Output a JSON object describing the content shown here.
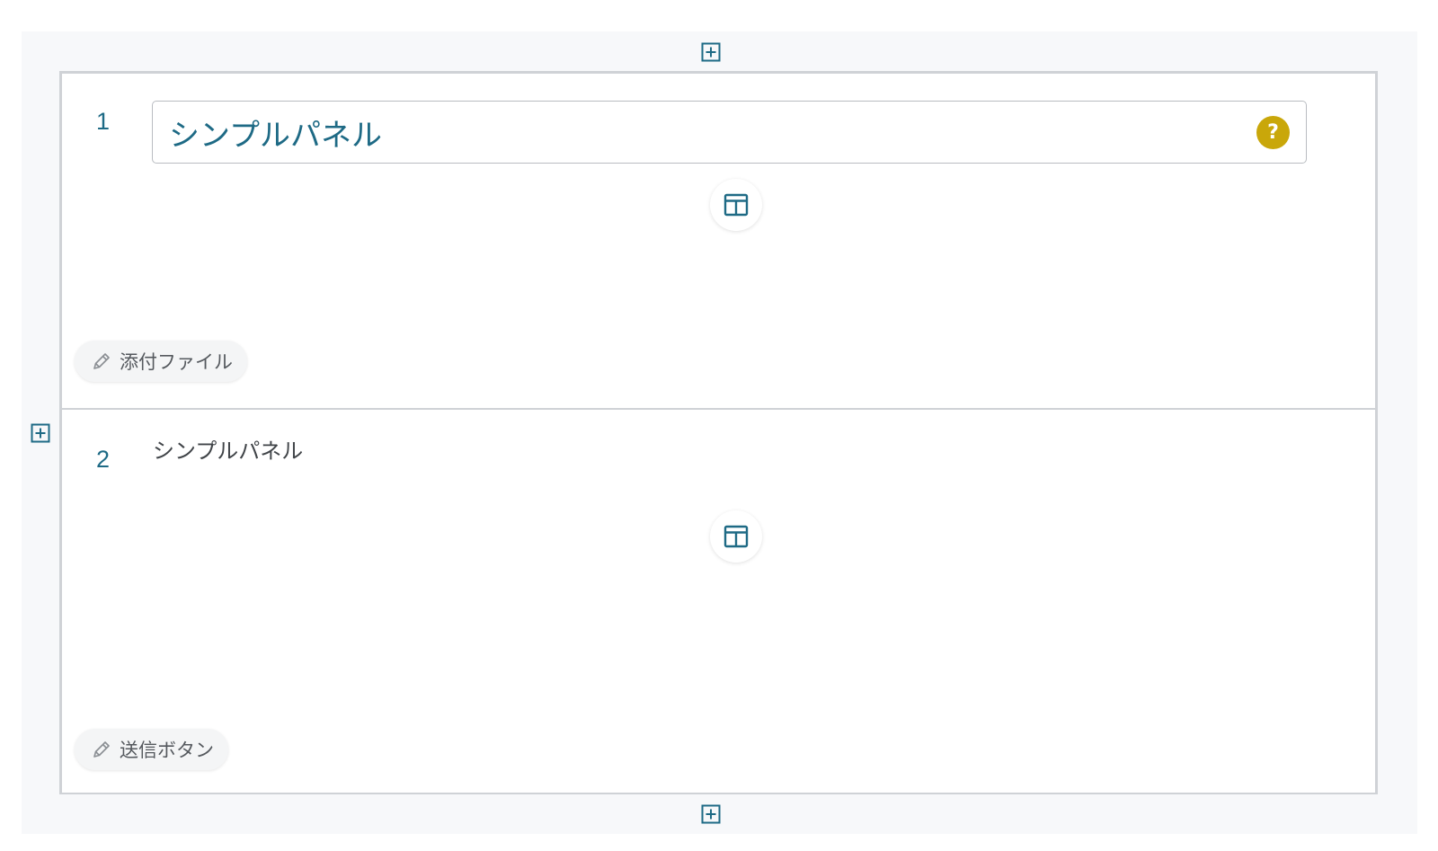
{
  "panels": [
    {
      "number": "1",
      "title": "シンプルパネル",
      "help_icon": "?",
      "layout_icon": "layout-icon",
      "footer_label": "添付ファイル"
    },
    {
      "number": "2",
      "title": "シンプルパネル",
      "layout_icon": "layout-icon",
      "footer_label": "送信ボタン"
    }
  ],
  "colors": {
    "accent": "#1e6a85",
    "help": "#c9a70a",
    "border": "#cfd2d6",
    "canvas": "#f7f8fa"
  },
  "icons": {
    "add": "plus-square-icon",
    "layout": "layout-icon",
    "edit": "pencil-icon",
    "help": "help-icon"
  }
}
